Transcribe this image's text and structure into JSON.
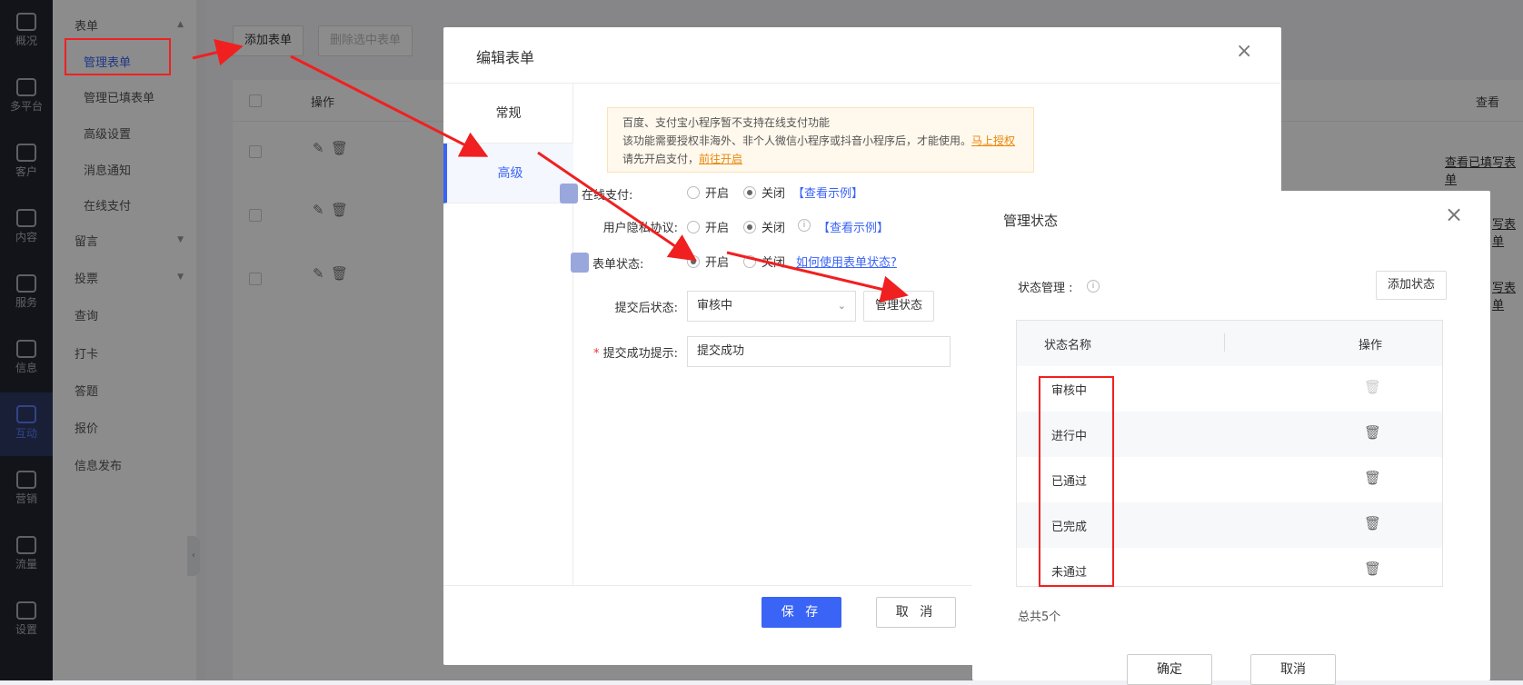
{
  "rail": [
    {
      "label": "概况",
      "icon": "chart-icon"
    },
    {
      "label": "多平台",
      "icon": "layers-icon"
    },
    {
      "label": "客户",
      "icon": "user-icon"
    },
    {
      "label": "内容",
      "icon": "document-icon"
    },
    {
      "label": "服务",
      "icon": "service-icon"
    },
    {
      "label": "信息",
      "icon": "message-icon"
    },
    {
      "label": "互动",
      "icon": "interact-icon"
    },
    {
      "label": "营销",
      "icon": "tag-icon"
    },
    {
      "label": "流量",
      "icon": "megaphone-icon"
    },
    {
      "label": "设置",
      "icon": "gear-icon"
    }
  ],
  "sidebar": {
    "group_form": "表单",
    "sub_items": [
      "管理表单",
      "管理已填表单",
      "高级设置",
      "消息通知",
      "在线支付"
    ],
    "group_msg": "留言",
    "group_vote": "投票",
    "others": [
      "查询",
      "打卡",
      "答题",
      "报价",
      "信息发布"
    ]
  },
  "background": {
    "add_form": "添加表单",
    "delete_selected": "删除选中表单",
    "col_ops": "操作",
    "col_view": "查看",
    "view_link": "查看已填写表单",
    "partial_link": "写表单"
  },
  "edit_dialog": {
    "title": "编辑表单",
    "tabs": [
      "常规",
      "高级"
    ],
    "notice_line1": "百度、支付宝小程序暂不支持在线支付功能",
    "notice_line2": "该功能需要授权非海外、非个人微信小程序或抖音小程序后，才能使用。",
    "notice_link1": "马上授权",
    "notice_line3": "请先开启支付，",
    "notice_link2": "前往开启",
    "online_pay_label": "在线支付:",
    "privacy_label": "用户隐私协议:",
    "form_state_label": "表单状态:",
    "opt_on": "开启",
    "opt_off": "关闭",
    "view_example": "【查看示例】",
    "how_to_use": "如何使用表单状态?",
    "after_submit_label": "提交后状态:",
    "after_submit_value": "审核中",
    "manage_state_btn": "管理状态",
    "success_tip_label": "提交成功提示:",
    "success_tip_value": "提交成功",
    "save": "保 存",
    "cancel": "取 消"
  },
  "manage_dialog": {
    "title": "管理状态",
    "state_mgmt_label": "状态管理 :",
    "add_state": "添加状态",
    "col_name": "状态名称",
    "col_ops": "操作",
    "rows": [
      "审核中",
      "进行中",
      "已通过",
      "已完成",
      "未通过"
    ],
    "total": "总共5个",
    "confirm": "确定",
    "cancel": "取消"
  },
  "colors": {
    "accent": "#3a64f5",
    "annotation": "#f02020",
    "warning_link": "#e8870a"
  }
}
